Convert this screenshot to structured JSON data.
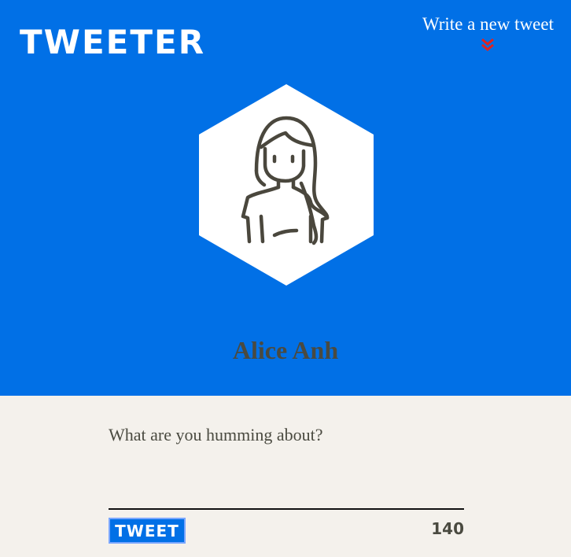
{
  "app": {
    "logo": "TWEETER"
  },
  "header": {
    "write_new_label": "Write a new tweet",
    "accent_color": "#0170e6",
    "chevron_icon": "double-chevron-down-icon",
    "chevron_color": "#e0231f"
  },
  "profile": {
    "name": "Alice Anh",
    "avatar_icon": "woman-avatar-icon"
  },
  "composer": {
    "placeholder": "What are you humming about?",
    "value": "",
    "tweet_button_label": "TWEET",
    "char_counter": "140"
  }
}
